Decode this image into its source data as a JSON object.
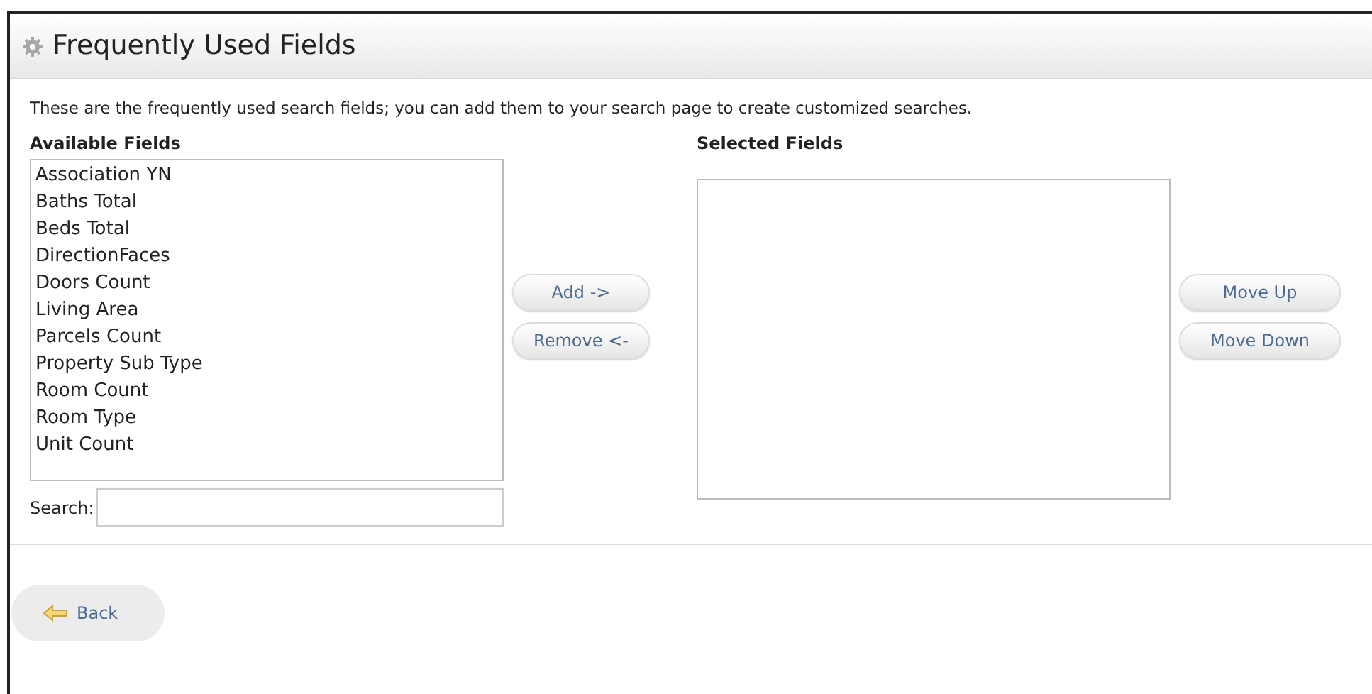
{
  "header": {
    "title": "Frequently Used Fields"
  },
  "description": "These are the frequently used search fields; you can add them to your search page to create customized searches.",
  "available": {
    "label": "Available Fields",
    "items": [
      "Association YN",
      "Baths Total",
      "Beds Total",
      "DirectionFaces",
      "Doors Count",
      "Living Area",
      "Parcels Count",
      "Property Sub Type",
      "Room Count",
      "Room Type",
      "Unit Count"
    ],
    "search_label": "Search:"
  },
  "transfer_buttons": [
    "Add ->",
    "Remove <-"
  ],
  "selected": {
    "label": "Selected Fields"
  },
  "order_buttons": [
    "Move Up",
    "Move Down"
  ],
  "back_button": "Back"
}
